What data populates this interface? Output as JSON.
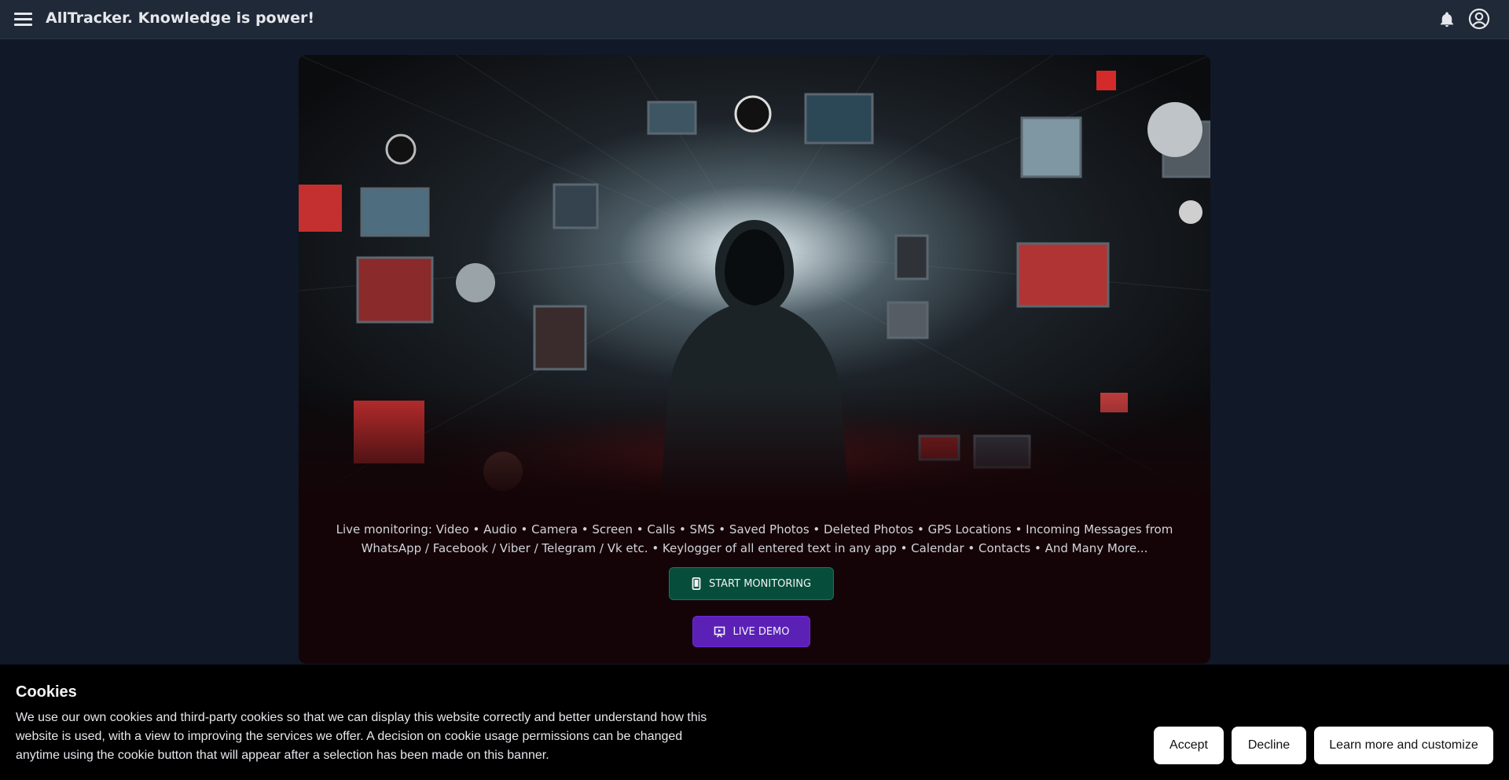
{
  "header": {
    "title": "AllTracker. Knowledge is power!",
    "menu_icon": "menu-icon",
    "bell_icon": "bell-icon",
    "account_icon": "account-circle-icon"
  },
  "hero": {
    "features_text": "Live monitoring: Video • Audio • Camera • Screen • Calls • SMS • Saved Photos • Deleted Photos • GPS Locations • Incoming Messages from WhatsApp / Facebook / Viber / Telegram / Vk etc. • Keylogger of all entered text in any app • Calendar • Contacts • And Many More...",
    "start_button": {
      "label": "START MONITORING",
      "icon": "smartphone-icon"
    },
    "demo_button": {
      "label": "LIVE DEMO",
      "icon": "presentation-icon"
    }
  },
  "cookies": {
    "title": "Cookies",
    "text": "We use our own cookies and third-party cookies so that we can display this website correctly and better understand how this website is used, with a view to improving the services we offer. A decision on cookie usage permissions can be changed anytime using the cookie button that will appear after a selection has been made on this banner.",
    "accept_label": "Accept",
    "decline_label": "Decline",
    "learn_label": "Learn more and customize"
  },
  "colors": {
    "header_bg": "#1f2937",
    "page_bg": "#111827",
    "start_button": "#064e3b",
    "demo_button": "#5b21b6",
    "cookie_bg": "#000000"
  }
}
